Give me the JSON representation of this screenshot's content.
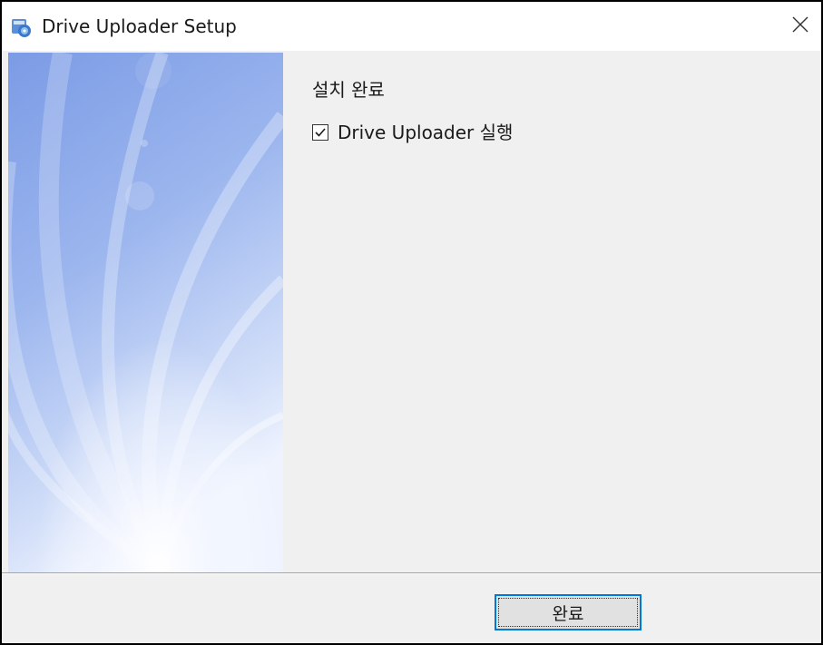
{
  "window": {
    "title": "Drive Uploader Setup"
  },
  "content": {
    "heading": "설치 완료",
    "launch_checkbox": {
      "label": "Drive Uploader 실행",
      "checked": true
    }
  },
  "footer": {
    "finish_button_label": "완료"
  },
  "icons": {
    "app": "setup-installer-icon",
    "close": "close-icon",
    "check": "checkmark-icon"
  },
  "colors": {
    "focus_border": "#0078d7",
    "banner_top": "#7fa0e6",
    "banner_bottom": "#e8eefc"
  }
}
